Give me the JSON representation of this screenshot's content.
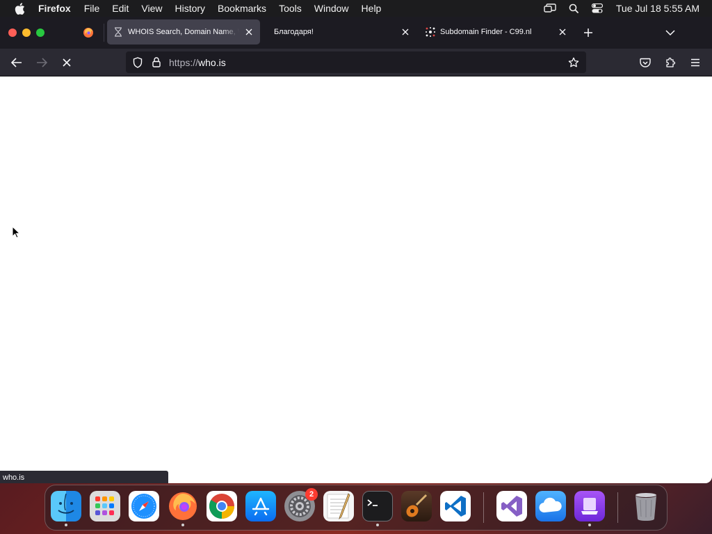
{
  "menubar": {
    "app_name": "Firefox",
    "items": [
      "File",
      "Edit",
      "View",
      "History",
      "Bookmarks",
      "Tools",
      "Window",
      "Help"
    ],
    "clock": "Tue Jul 18  5:55 AM",
    "icons": [
      "screen-mirroring-icon",
      "spotlight-search-icon",
      "control-center-icon"
    ]
  },
  "browser": {
    "tabs": [
      {
        "title": "WHOIS Search, Domain Name, Website, and IP Tools - Who.is",
        "favicon": "hourglass-icon",
        "active": true
      },
      {
        "title": "Благодаря!",
        "favicon": "",
        "active": false
      },
      {
        "title": "Subdomain Finder - C99.nl",
        "favicon": "c99-icon",
        "active": false
      }
    ],
    "url": {
      "scheme": "https://",
      "host": "who.is"
    },
    "status_text": "who.is",
    "colors": {
      "tabbar": "#1c1b22",
      "active_tab": "#42414d",
      "toolbar": "#2b2a33",
      "urlbar": "#1c1b22"
    }
  },
  "dock": {
    "apps": [
      {
        "name": "Finder",
        "running": true
      },
      {
        "name": "Launchpad",
        "running": false
      },
      {
        "name": "Safari",
        "running": false
      },
      {
        "name": "Firefox",
        "running": true
      },
      {
        "name": "Google Chrome",
        "running": false
      },
      {
        "name": "App Store",
        "running": false
      },
      {
        "name": "System Settings",
        "running": false,
        "badge": "2"
      },
      {
        "name": "TextEdit",
        "running": false
      },
      {
        "name": "Terminal",
        "running": true
      },
      {
        "name": "GarageBand",
        "running": false
      },
      {
        "name": "Visual Studio Code",
        "running": false
      },
      {
        "name": "Visual Studio",
        "running": false
      },
      {
        "name": "iCloud",
        "running": false
      },
      {
        "name": "Apple Configurator",
        "running": true
      },
      {
        "name": "Trash",
        "running": false
      }
    ]
  }
}
